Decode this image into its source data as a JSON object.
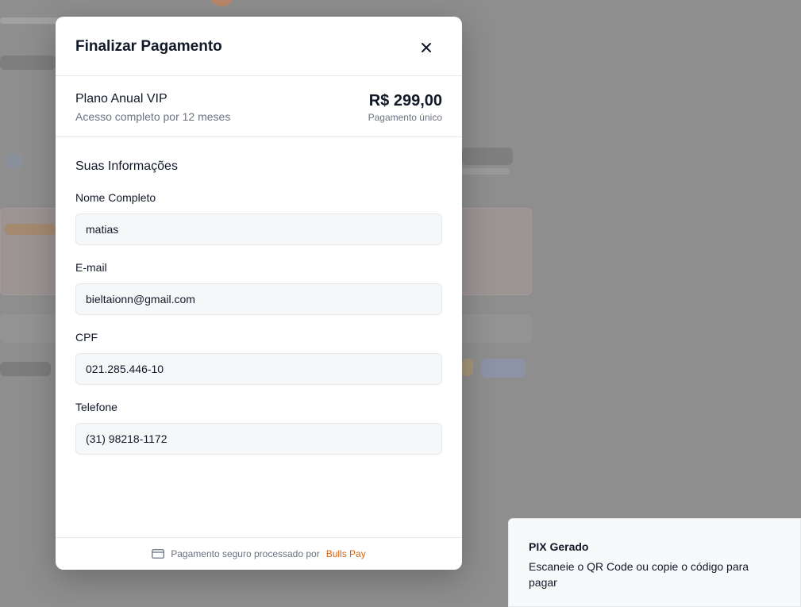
{
  "modal": {
    "title": "Finalizar Pagamento",
    "close_icon": "close-icon"
  },
  "plan": {
    "name": "Plano Anual VIP",
    "description": "Acesso completo por 12 meses",
    "price": "R$ 299,00",
    "price_note": "Pagamento único"
  },
  "form": {
    "section_title": "Suas Informações",
    "fields": [
      {
        "label": "Nome Completo",
        "value": "matias"
      },
      {
        "label": "E-mail",
        "value": "bieltaionn@gmail.com"
      },
      {
        "label": "CPF",
        "value": "021.285.446-10"
      },
      {
        "label": "Telefone",
        "value": "(31) 98218-1172"
      }
    ]
  },
  "footer": {
    "icon": "credit-card-icon",
    "text": "Pagamento seguro processado por",
    "brand": "Bulls Pay"
  },
  "toast": {
    "title": "PIX Gerado",
    "message": "Escaneie o QR Code ou copie o código para pagar"
  },
  "colors": {
    "accent": "#d9620c",
    "backdrop": "#8e8e8e"
  }
}
